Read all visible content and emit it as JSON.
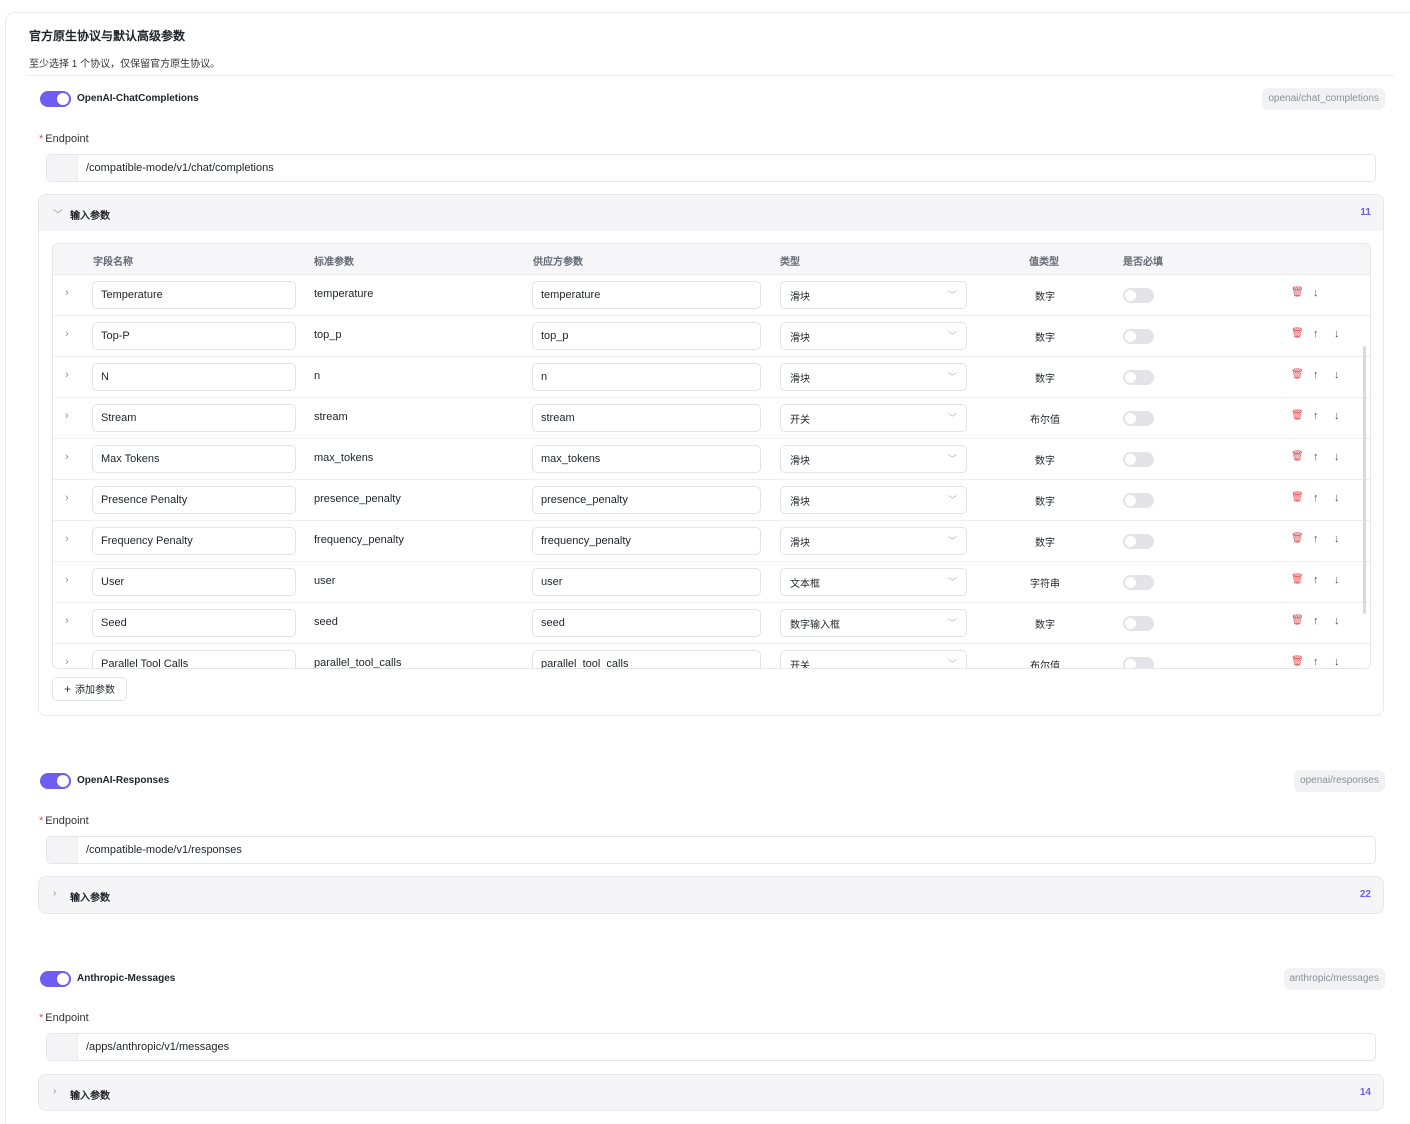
{
  "section": {
    "title": "官方原生协议与默认高级参数",
    "subtitle": "至少选择 1 个协议，仅保留官方原生协议。"
  },
  "common": {
    "endpoint_label": "Endpoint",
    "required_mark": "*",
    "params_label": "输入参数",
    "add_param_label": "添加参数"
  },
  "protocols": [
    {
      "name": "OpenAI-ChatCompletions",
      "tag": "openai/chat_completions",
      "enabled": true,
      "endpoint": "/compatible-mode/v1/chat/completions",
      "param_count": "11",
      "expanded": true
    },
    {
      "name": "OpenAI-Responses",
      "tag": "openai/responses",
      "enabled": true,
      "endpoint": "/compatible-mode/v1/responses",
      "param_count": "22",
      "expanded": false
    },
    {
      "name": "Anthropic-Messages",
      "tag": "anthropic/messages",
      "enabled": true,
      "endpoint": "/apps/anthropic/v1/messages",
      "param_count": "14",
      "expanded": false
    }
  ],
  "table": {
    "headers": [
      "字段名称",
      "标准参数",
      "供应方参数",
      "类型",
      "值类型",
      "是否必填"
    ],
    "rows": [
      {
        "name": "Temperature",
        "standard": "temperature",
        "provider": "temperature",
        "type": "滑块",
        "value_type": "数字",
        "required": false
      },
      {
        "name": "Top-P",
        "standard": "top_p",
        "provider": "top_p",
        "type": "滑块",
        "value_type": "数字",
        "required": false
      },
      {
        "name": "N",
        "standard": "n",
        "provider": "n",
        "type": "滑块",
        "value_type": "数字",
        "required": false
      },
      {
        "name": "Stream",
        "standard": "stream",
        "provider": "stream",
        "type": "开关",
        "value_type": "布尔值",
        "required": false
      },
      {
        "name": "Max Tokens",
        "standard": "max_tokens",
        "provider": "max_tokens",
        "type": "滑块",
        "value_type": "数字",
        "required": false
      },
      {
        "name": "Presence Penalty",
        "standard": "presence_penalty",
        "provider": "presence_penalty",
        "type": "滑块",
        "value_type": "数字",
        "required": false
      },
      {
        "name": "Frequency Penalty",
        "standard": "frequency_penalty",
        "provider": "frequency_penalty",
        "type": "滑块",
        "value_type": "数字",
        "required": false
      },
      {
        "name": "User",
        "standard": "user",
        "provider": "user",
        "type": "文本框",
        "value_type": "字符串",
        "required": false
      },
      {
        "name": "Seed",
        "standard": "seed",
        "provider": "seed",
        "type": "数字输入框",
        "value_type": "数字",
        "required": false
      },
      {
        "name": "Parallel Tool Calls",
        "standard": "parallel_tool_calls",
        "provider": "parallel_tool_calls",
        "type": "开关",
        "value_type": "布尔值",
        "required": false
      }
    ]
  },
  "icons": {
    "expand": "chevron-right-icon",
    "collapse": "chevron-down-icon",
    "delete": "trash-icon",
    "up": "arrow-up-icon",
    "down": "arrow-down-icon",
    "add": "plus-icon"
  },
  "colors": {
    "accent": "#6f5cf1",
    "danger": "#e5484d"
  }
}
